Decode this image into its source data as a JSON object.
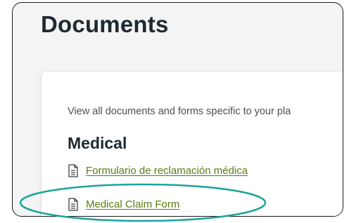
{
  "page": {
    "title": "Documents"
  },
  "card": {
    "description": "View all documents and forms specific to your pla",
    "section_title": "Medical",
    "links": [
      {
        "label": "Formulario de reclamación médica",
        "icon": "document-icon"
      },
      {
        "label": "Medical Claim Form",
        "icon": "document-icon"
      }
    ]
  },
  "colors": {
    "link": "#5a7a12",
    "highlight": "#1aa39a",
    "title": "#1e2a32",
    "background": "#f4f4f4"
  }
}
